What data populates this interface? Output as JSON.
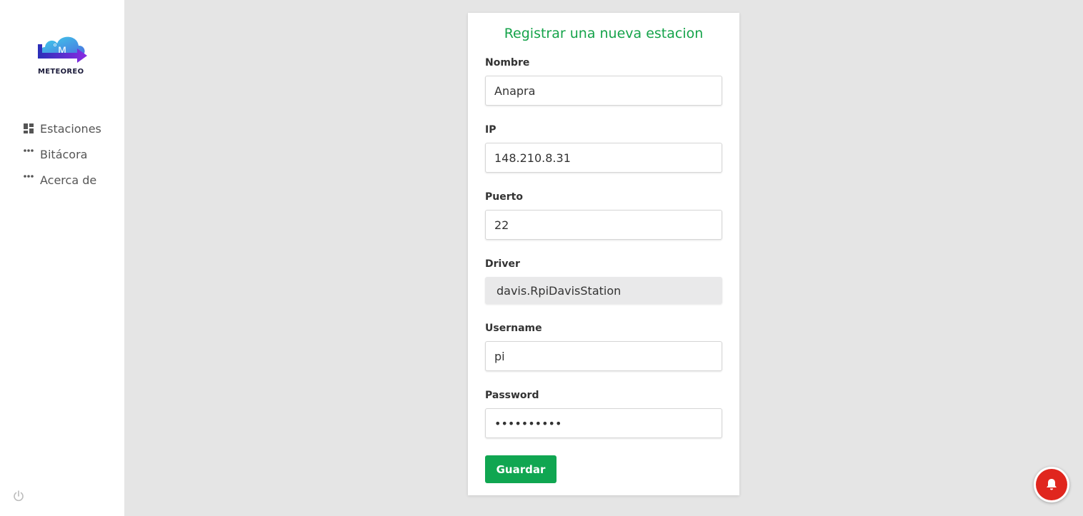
{
  "app": {
    "logo_text": "METEOREO"
  },
  "sidebar": {
    "items": [
      {
        "label": "Estaciones",
        "icon": "dashboard-icon"
      },
      {
        "label": "Bitácora",
        "icon": "more-horizontal-icon"
      },
      {
        "label": "Acerca de",
        "icon": "more-horizontal-icon"
      }
    ],
    "power_icon": "power-icon"
  },
  "form": {
    "title": "Registrar una nueva estacion",
    "nombre": {
      "label": "Nombre",
      "value": "Anapra"
    },
    "ip": {
      "label": "IP",
      "value": "148.210.8.31"
    },
    "puerto": {
      "label": "Puerto",
      "value": "22"
    },
    "driver": {
      "label": "Driver",
      "value": "davis.RpiDavisStation"
    },
    "username": {
      "label": "Username",
      "value": "pi"
    },
    "password": {
      "label": "Password",
      "value": "••••••••••"
    },
    "save_label": "Guardar"
  },
  "colors": {
    "accent": "#15a34a",
    "button": "#10a651",
    "notification": "#e0261e",
    "background": "#e5e5e5"
  }
}
